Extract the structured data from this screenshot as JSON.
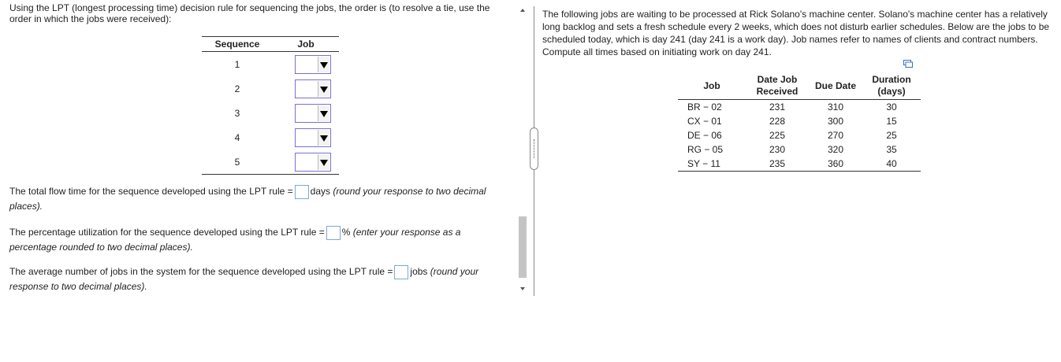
{
  "left": {
    "intro": "Using the LPT (longest processing time) decision rule for sequencing the jobs, the order is (to resolve a tie, use the order in which the jobs were received):",
    "seq_table": {
      "headers": [
        "Sequence",
        "Job"
      ],
      "rows": [
        "1",
        "2",
        "3",
        "4",
        "5"
      ]
    },
    "q1": {
      "pre": "The total flow time for the sequence developed using the LPT rule =",
      "unit": "days",
      "hint": "(round your response to two decimal places)."
    },
    "q2": {
      "pre": "The percentage utilization for the sequence developed using the LPT rule =",
      "unit": "%",
      "hint": "(enter your response as a percentage rounded to two decimal places)."
    },
    "q3": {
      "pre": "The average number of jobs in the system for the sequence developed using the LPT rule =",
      "unit": "jobs",
      "hint": "(round your response to two decimal places)."
    }
  },
  "right": {
    "intro": "The following jobs are waiting to be processed at Rick Solano's machine center. Solano's machine center has a relatively long backlog and sets a fresh schedule every 2 weeks, which does not disturb earlier schedules. Below are the jobs to be scheduled today, which is day 241 (day 241 is a work day). Job names refer to names of clients and contract numbers. Compute all times based on initiating work on day 241.",
    "table": {
      "headers": [
        "Job",
        "Date Job Received",
        "Due Date",
        "Duration (days)"
      ],
      "rows": [
        [
          "BR − 02",
          "231",
          "310",
          "30"
        ],
        [
          "CX − 01",
          "228",
          "300",
          "15"
        ],
        [
          "DE − 06",
          "225",
          "270",
          "25"
        ],
        [
          "RG − 05",
          "230",
          "320",
          "35"
        ],
        [
          "SY − 11",
          "235",
          "360",
          "40"
        ]
      ]
    }
  },
  "icons": {
    "copy": "copy-icon",
    "dropdown": "chevron-down-icon"
  },
  "colors": {
    "input_border": "#7fa7d8",
    "dropdown_border": "#7a6fd4"
  }
}
